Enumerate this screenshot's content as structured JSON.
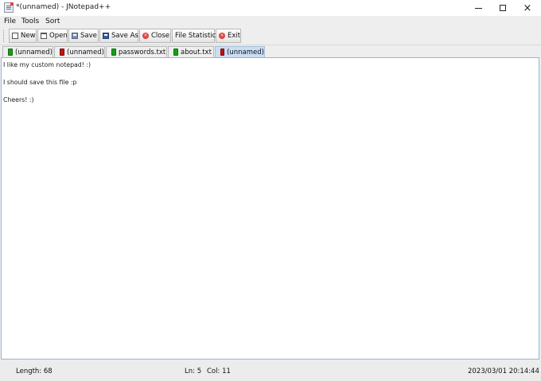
{
  "window": {
    "title": "*(unnamed) - JNotepad++",
    "app_icon": "java-app-icon",
    "controls": {
      "minimize": "minimize-icon",
      "maximize": "maximize-icon",
      "close": "close-icon"
    }
  },
  "menu": {
    "file": "File",
    "tools": "Tools",
    "sort": "Sort"
  },
  "toolbar": {
    "new_label": "New",
    "open_label": "Open",
    "save_label": "Save",
    "save_as_label": "Save As",
    "close_label": "Close",
    "file_statistic_label": "File Statistic",
    "exit_label": "Exit"
  },
  "tabs": [
    {
      "label": "(unnamed)",
      "status_color": "#12a312",
      "active": false
    },
    {
      "label": "(unnamed)",
      "status_color": "#c51111",
      "active": false
    },
    {
      "label": "passwords.txt",
      "status_color": "#12a312",
      "active": false
    },
    {
      "label": "about.txt",
      "status_color": "#12a312",
      "active": false
    },
    {
      "label": "(unnamed)",
      "status_color": "#c51111",
      "active": true
    }
  ],
  "editor": {
    "lines": [
      "I like my custom notepad! :)",
      "",
      "I should save this file :p",
      "",
      "Cheers! :)"
    ]
  },
  "status": {
    "length": "Length: 68",
    "ln": "Ln: 5",
    "col": "Col: 11",
    "datetime": "2023/03/01 20:14:44"
  },
  "colors": {
    "active_tab": "#c9ddf5",
    "editor_border": "#99b4d1",
    "saved_file": "#12a312",
    "unsaved_file": "#c51111"
  }
}
